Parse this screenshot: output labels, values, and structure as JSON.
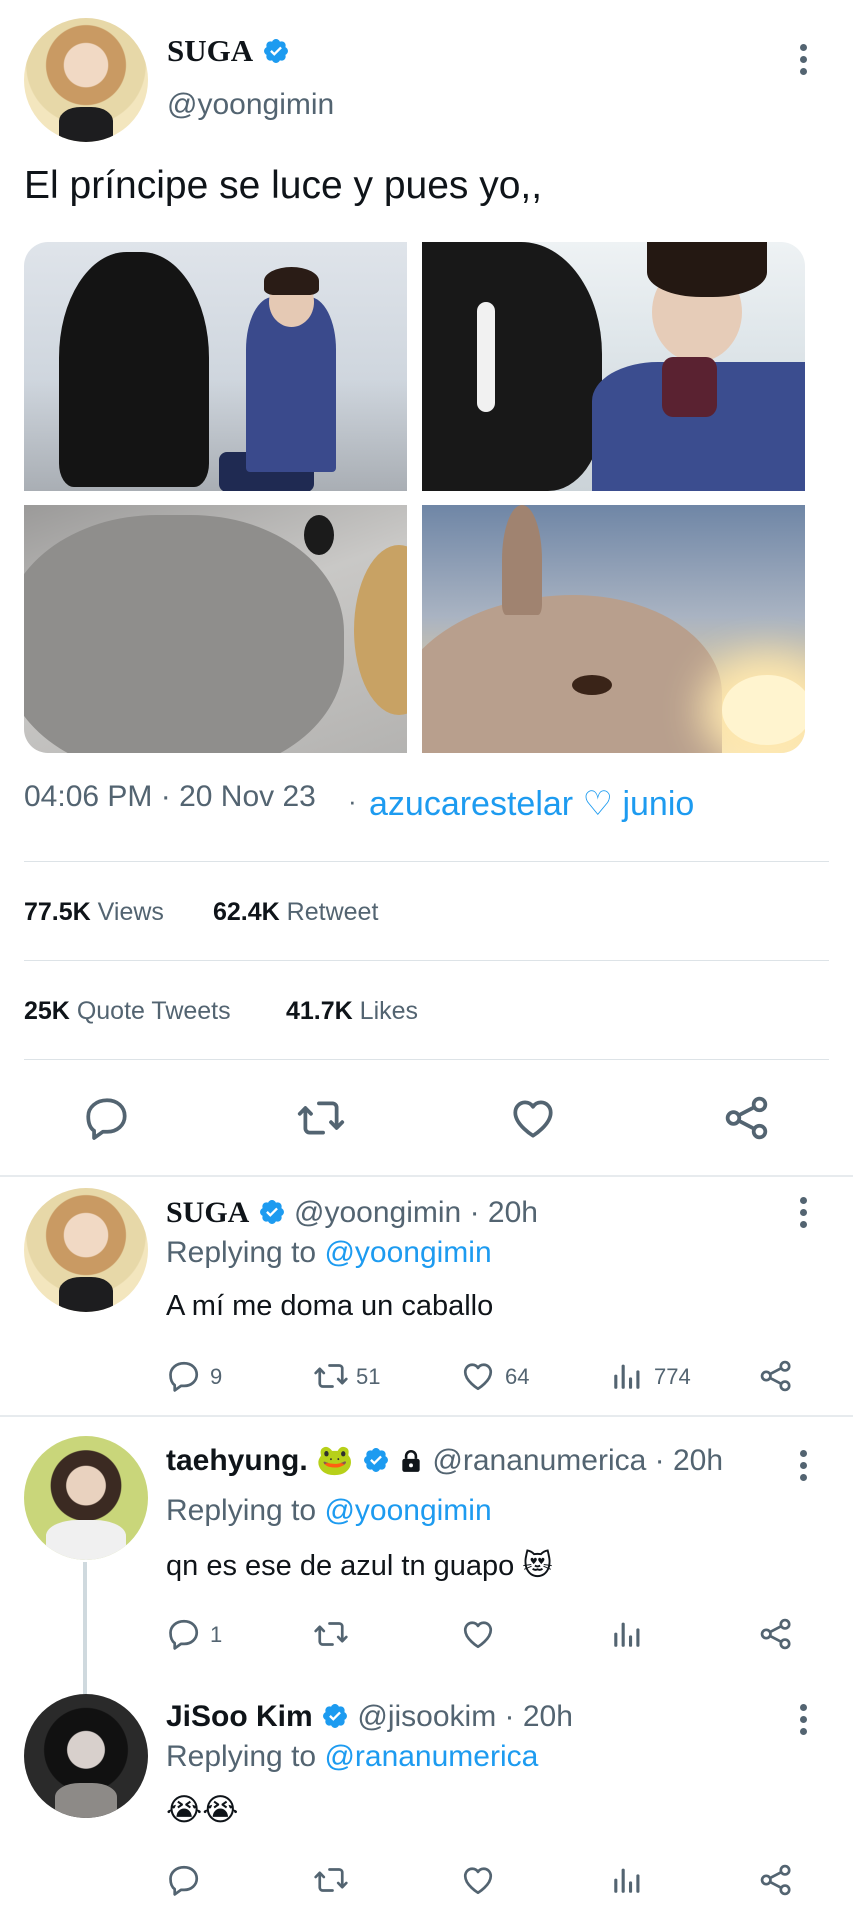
{
  "main_tweet": {
    "author_name": "SUGA",
    "author_handle": "@yoongimin",
    "text": "El príncipe se luce y pues yo,,",
    "timestamp": "04:06 PM · 20 Nov 23",
    "separator": "·",
    "source_label": "azucarestelar ♡ junio",
    "views_count": "77.5K",
    "views_label": "Views",
    "retweet_count": "62.4K",
    "retweet_label": "Retweet",
    "quote_count": "25K",
    "quote_label": "Quote Tweets",
    "likes_count": "41.7K",
    "likes_label": "Likes"
  },
  "replies": [
    {
      "author_name": "SUGA",
      "author_handle": "@yoongimin",
      "time": "· 20h",
      "replying_prefix": "Replying to",
      "replying_to": "@yoongimin",
      "text": "A mí me doma un caballo",
      "reply_count": "9",
      "retweet_count": "51",
      "like_count": "64",
      "view_count": "774"
    },
    {
      "author_name": "taehyung.",
      "author_emoji": "🐸",
      "author_handle": "@rananumerica",
      "time": "· 20h",
      "replying_prefix": "Replying to",
      "replying_to": "@yoongimin",
      "text": "qn es ese de azul tn guapo",
      "text_emoji": "😻",
      "reply_count": "1"
    },
    {
      "author_name": "JiSoo Kim",
      "author_handle": "@jisookim",
      "time": "· 20h",
      "replying_prefix": "Replying to",
      "replying_to": "@rananumerica",
      "text_emoji": "😭😭"
    }
  ],
  "colors": {
    "accent": "#1d9bf0",
    "muted": "#536471",
    "text": "#0f1419"
  },
  "icons": [
    "verified-badge-icon",
    "more-options-icon",
    "reply-icon",
    "retweet-icon",
    "like-icon",
    "share-icon",
    "views-icon",
    "lock-icon"
  ]
}
